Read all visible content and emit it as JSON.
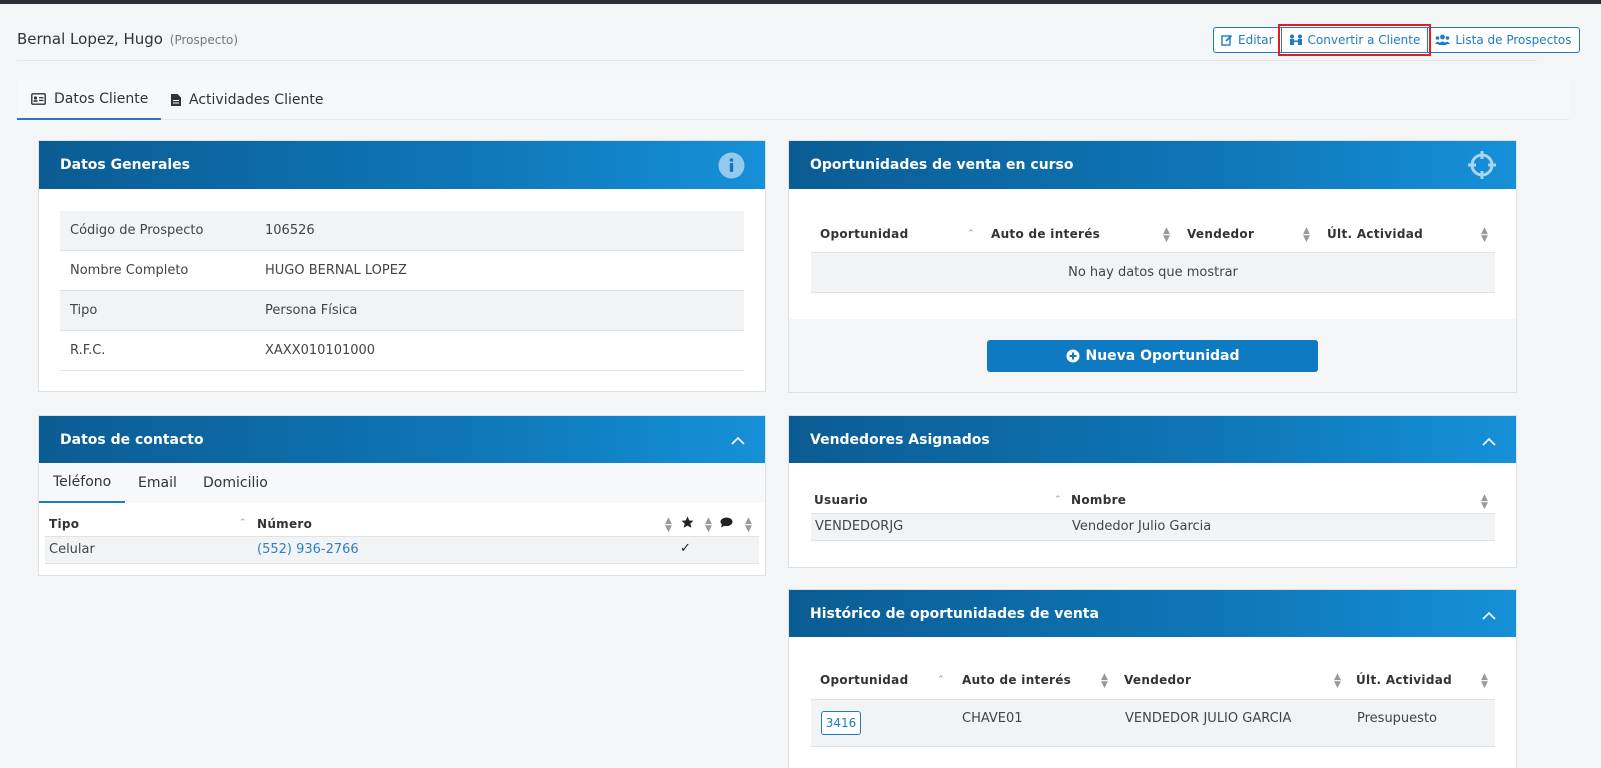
{
  "header": {
    "name": "Bernal Lopez, Hugo",
    "status": "(Prospecto)",
    "buttons": {
      "edit": "Editar",
      "convert": "Convertir a Cliente",
      "list": "Lista de Prospectos"
    }
  },
  "tabs": [
    {
      "label": "Datos Cliente",
      "icon": "id-card-icon"
    },
    {
      "label": "Actividades Cliente",
      "icon": "document-icon"
    }
  ],
  "general": {
    "title": "Datos Generales",
    "rows": [
      {
        "label": "Código de Prospecto",
        "value": "106526"
      },
      {
        "label": "Nombre Completo",
        "value": "HUGO BERNAL LOPEZ"
      },
      {
        "label": "Tipo",
        "value": "Persona Física"
      },
      {
        "label": "R.F.C.",
        "value": "XAXX010101000"
      }
    ]
  },
  "contact": {
    "title": "Datos de contacto",
    "tabs": [
      "Teléfono",
      "Email",
      "Domicilio"
    ],
    "columns": [
      "Tipo",
      "Número"
    ],
    "rows": [
      {
        "tipo": "Celular",
        "numero": "(552) 936-2766",
        "favorite_mark": "✓"
      }
    ]
  },
  "opportunities": {
    "title": "Oportunidades de venta en curso",
    "columns": [
      "Oportunidad",
      "Auto de interés",
      "Vendedor",
      "Últ. Actividad"
    ],
    "empty": "No hay datos que mostrar",
    "new_button": "Nueva Oportunidad"
  },
  "sellers": {
    "title": "Vendedores Asignados",
    "columns": [
      "Usuario",
      "Nombre"
    ],
    "rows": [
      {
        "usuario": "VENDEDORJG",
        "nombre": "Vendedor Julio Garcia"
      }
    ]
  },
  "history": {
    "title": "Histórico de oportunidades de venta",
    "columns": [
      "Oportunidad",
      "Auto de interés",
      "Vendedor",
      "Últ. Actividad"
    ],
    "rows": [
      {
        "oportunidad": "3416",
        "auto": "CHAVE01",
        "vendedor": "VENDEDOR JULIO GARCIA",
        "actividad": "Presupuesto"
      }
    ]
  },
  "colors": {
    "accent": "#1e7bc4",
    "header_gradient_start": "#0b5c93",
    "header_gradient_end": "#1690d8",
    "highlight": "#e02020"
  }
}
